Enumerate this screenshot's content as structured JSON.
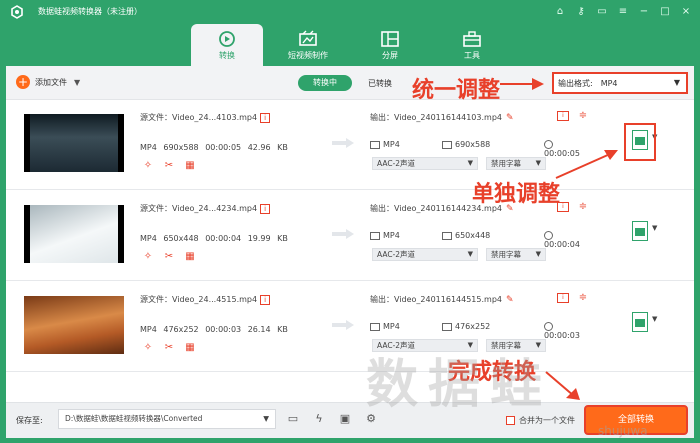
{
  "app": {
    "title": "数据蛙视频转换器（未注册）"
  },
  "nav": {
    "tabs": [
      {
        "label": "转换",
        "active": true
      },
      {
        "label": "短视频制作",
        "active": false
      },
      {
        "label": "分屏",
        "active": false
      },
      {
        "label": "工具",
        "active": false
      }
    ]
  },
  "toolbar": {
    "add_file": "添加文件",
    "converting": "转换中",
    "converted": "已转换",
    "output_format_label": "输出格式:",
    "output_format_value": "MP4"
  },
  "files": [
    {
      "source": "源文件：Video_24...4103.mp4",
      "format": "MP4",
      "resolution": "690x588",
      "duration": "00:00:05",
      "size": "42.96 KB",
      "output": "输出：Video_240116144103.mp4",
      "out_format": "MP4",
      "out_resolution": "690x588",
      "out_duration": "00:00:05",
      "audio": "AAC-2声道",
      "subtitle": "禁用字幕",
      "thumb_colors": [
        "#1c2a33",
        "#3b4d57"
      ]
    },
    {
      "source": "源文件：Video_24...4234.mp4",
      "format": "MP4",
      "resolution": "650x448",
      "duration": "00:00:04",
      "size": "19.99 KB",
      "output": "输出：Video_240116144234.mp4",
      "out_format": "MP4",
      "out_resolution": "650x448",
      "out_duration": "00:00:04",
      "audio": "AAC-2声道",
      "subtitle": "禁用字幕",
      "thumb_colors": [
        "#cfd8dc",
        "#f3f6f7"
      ]
    },
    {
      "source": "源文件：Video_24...4515.mp4",
      "format": "MP4",
      "resolution": "476x252",
      "duration": "00:00:03",
      "size": "26.14 KB",
      "output": "输出：Video_240116144515.mp4",
      "out_format": "MP4",
      "out_resolution": "476x252",
      "out_duration": "00:00:03",
      "audio": "AAC-2声道",
      "subtitle": "禁用字幕",
      "thumb_colors": [
        "#b45a26",
        "#d98a48"
      ]
    }
  ],
  "bottom": {
    "save_to": "保存至:",
    "path": "D:\\数据蛙\\数据蛙视频转换器\\Converted",
    "merge": "合并为一个文件",
    "convert_all": "全部转换"
  },
  "annotations": {
    "unified": "统一调整",
    "individual": "单独调整",
    "finish": "完成转换",
    "watermark": "数据蛙",
    "watermark_small": "shujuwa"
  },
  "colors": {
    "brand": "#2fa36b",
    "accent": "#ff6a1a",
    "annotation": "#e8402a"
  }
}
